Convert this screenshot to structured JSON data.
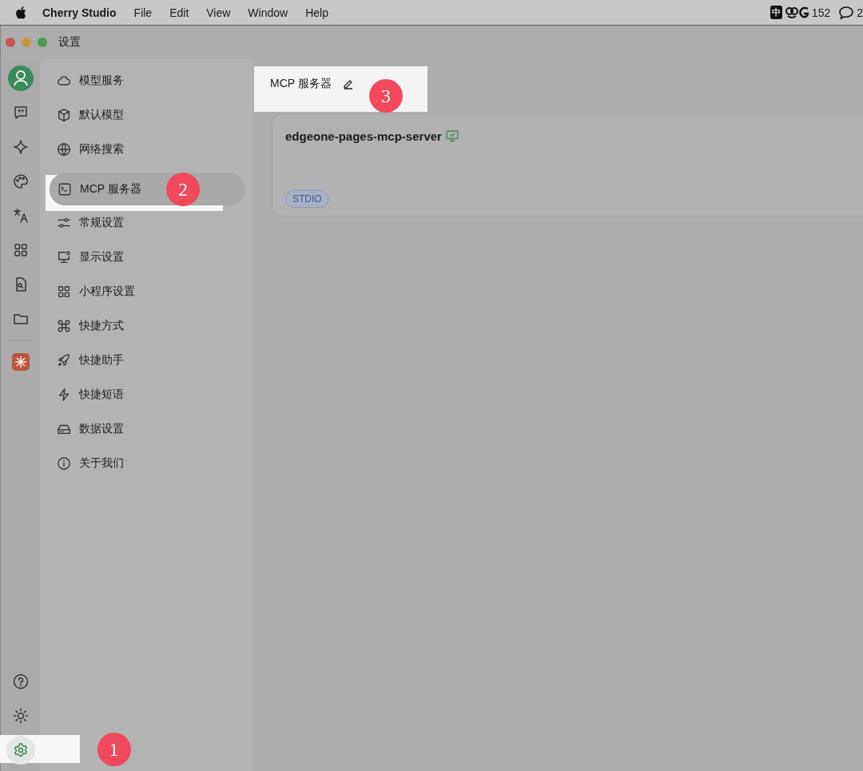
{
  "menu_bar": {
    "app_name": "Cherry Studio",
    "menus": [
      "File",
      "Edit",
      "View",
      "Window",
      "Help"
    ],
    "input_method": "中",
    "count": "152",
    "count_2": "2"
  },
  "window": {
    "title": "设置"
  },
  "rail": {
    "top": [
      {
        "kind": "avatar",
        "selected": false
      },
      {
        "kind": "chat",
        "selected": false
      },
      {
        "kind": "sparkle",
        "selected": false
      },
      {
        "kind": "palette",
        "selected": false
      },
      {
        "kind": "translate",
        "selected": false
      },
      {
        "kind": "apps",
        "selected": false
      },
      {
        "kind": "file",
        "selected": false
      },
      {
        "kind": "folder",
        "selected": false
      },
      {
        "kind": "logo",
        "selected": false
      }
    ],
    "bottom": [
      {
        "kind": "help",
        "selected": false
      },
      {
        "kind": "theme",
        "selected": false
      },
      {
        "kind": "settings",
        "selected": true,
        "callout": "1"
      }
    ]
  },
  "settings_menu": [
    {
      "label": "模型服务",
      "kind": "cloud",
      "selected": false
    },
    {
      "label": "默认模型",
      "kind": "cube",
      "selected": false
    },
    {
      "label": "网络搜索",
      "kind": "globe",
      "selected": false
    },
    {
      "label": "MCP 服务器",
      "kind": "terminal",
      "selected": true,
      "callout": "2"
    },
    {
      "label": "常规设置",
      "kind": "sliders",
      "selected": false
    },
    {
      "label": "显示设置",
      "kind": "monitor",
      "selected": false
    },
    {
      "label": "小程序设置",
      "kind": "apps",
      "selected": false
    },
    {
      "label": "快捷方式",
      "kind": "command",
      "selected": false
    },
    {
      "label": "快捷助手",
      "kind": "rocket",
      "selected": false
    },
    {
      "label": "快捷短语",
      "kind": "bolt",
      "selected": false
    },
    {
      "label": "数据设置",
      "kind": "drive",
      "selected": false
    },
    {
      "label": "关于我们",
      "kind": "info",
      "selected": false
    }
  ],
  "content": {
    "title": "MCP 服务器",
    "callout": "3",
    "servers": [
      {
        "name": "edgeone-pages-mcp-server",
        "tag": "STDIO"
      }
    ]
  }
}
